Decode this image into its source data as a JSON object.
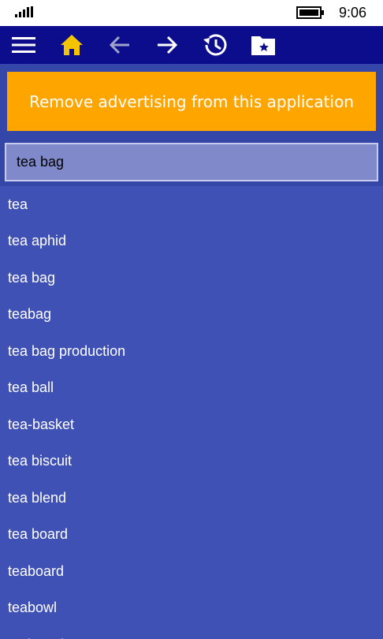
{
  "status_bar": {
    "time": "9:06",
    "signal_icon": "signal-strength-icon",
    "battery_icon": "battery-icon"
  },
  "toolbar": {
    "buttons": [
      {
        "name": "menu-button",
        "icon": "hamburger-menu-icon"
      },
      {
        "name": "home-button",
        "icon": "home-icon",
        "color": "#f5c400"
      },
      {
        "name": "back-button",
        "icon": "arrow-left-icon",
        "color": "#9fa3c8"
      },
      {
        "name": "forward-button",
        "icon": "arrow-right-icon",
        "color": "#ffffff"
      },
      {
        "name": "history-button",
        "icon": "history-icon"
      },
      {
        "name": "favorites-button",
        "icon": "star-folder-icon"
      }
    ]
  },
  "ad": {
    "text": "Remove advertising from this application",
    "color": "#ffa500"
  },
  "search": {
    "value": "tea bag"
  },
  "results": [
    "tea",
    "tea aphid",
    "tea bag",
    "teabag",
    "tea bag production",
    "tea ball",
    "tea-basket",
    "tea biscuit",
    "tea blend",
    "tea board",
    "teaboard",
    "teabowl",
    "teabread"
  ],
  "colors": {
    "toolbar_bg": "#0b0d8c",
    "list_bg": "#3f51b5",
    "search_bg": "#8089c9"
  }
}
